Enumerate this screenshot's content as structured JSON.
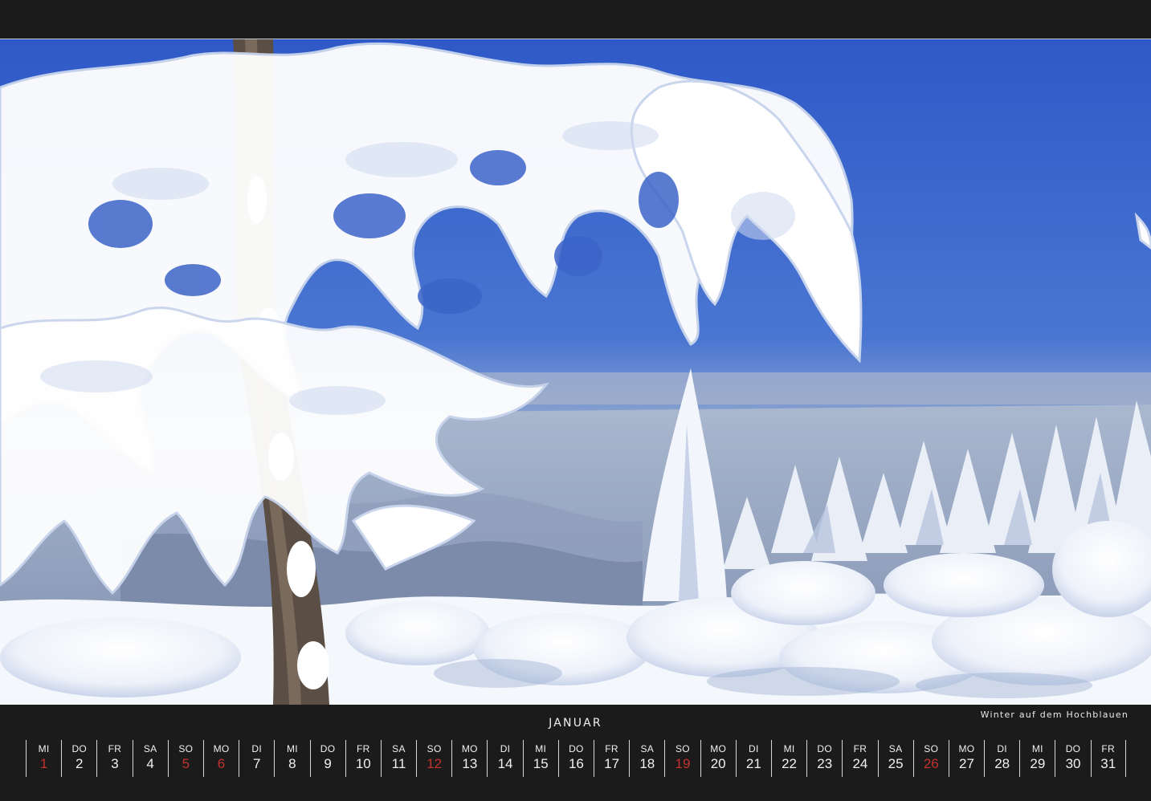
{
  "caption": "Winter auf dem Hochblauen",
  "month": "JANUAR",
  "colors": {
    "background": "#1b1b1b",
    "text": "#f0f0f0",
    "holiday": "#c2322f",
    "sky": "#3a63c9",
    "snow": "#f4f7fb"
  },
  "days": [
    {
      "wd": "MI",
      "num": "1",
      "red": true
    },
    {
      "wd": "DO",
      "num": "2",
      "red": false
    },
    {
      "wd": "FR",
      "num": "3",
      "red": false
    },
    {
      "wd": "SA",
      "num": "4",
      "red": false
    },
    {
      "wd": "SO",
      "num": "5",
      "red": true
    },
    {
      "wd": "MO",
      "num": "6",
      "red": true
    },
    {
      "wd": "DI",
      "num": "7",
      "red": false
    },
    {
      "wd": "MI",
      "num": "8",
      "red": false
    },
    {
      "wd": "DO",
      "num": "9",
      "red": false
    },
    {
      "wd": "FR",
      "num": "10",
      "red": false
    },
    {
      "wd": "SA",
      "num": "11",
      "red": false
    },
    {
      "wd": "SO",
      "num": "12",
      "red": true
    },
    {
      "wd": "MO",
      "num": "13",
      "red": false
    },
    {
      "wd": "DI",
      "num": "14",
      "red": false
    },
    {
      "wd": "MI",
      "num": "15",
      "red": false
    },
    {
      "wd": "DO",
      "num": "16",
      "red": false
    },
    {
      "wd": "FR",
      "num": "17",
      "red": false
    },
    {
      "wd": "SA",
      "num": "18",
      "red": false
    },
    {
      "wd": "SO",
      "num": "19",
      "red": true
    },
    {
      "wd": "MO",
      "num": "20",
      "red": false
    },
    {
      "wd": "DI",
      "num": "21",
      "red": false
    },
    {
      "wd": "MI",
      "num": "22",
      "red": false
    },
    {
      "wd": "DO",
      "num": "23",
      "red": false
    },
    {
      "wd": "FR",
      "num": "24",
      "red": false
    },
    {
      "wd": "SA",
      "num": "25",
      "red": false
    },
    {
      "wd": "SO",
      "num": "26",
      "red": true
    },
    {
      "wd": "MO",
      "num": "27",
      "red": false
    },
    {
      "wd": "DI",
      "num": "28",
      "red": false
    },
    {
      "wd": "MI",
      "num": "29",
      "red": false
    },
    {
      "wd": "DO",
      "num": "30",
      "red": false
    },
    {
      "wd": "FR",
      "num": "31",
      "red": false
    }
  ]
}
